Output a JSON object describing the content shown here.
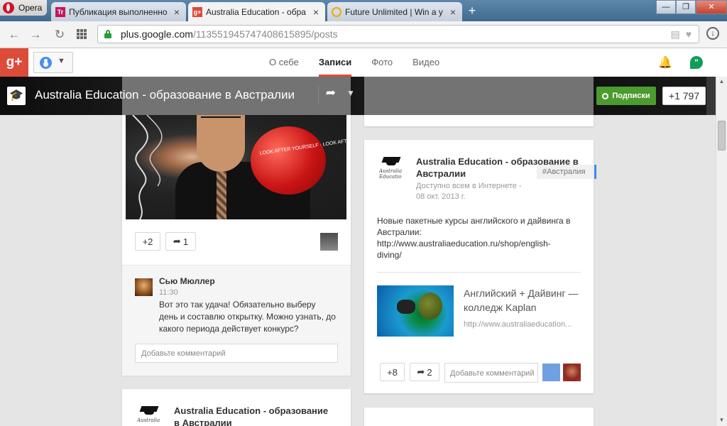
{
  "browser": {
    "app_name": "Opera",
    "tabs": [
      {
        "title": "Публикация выполненно",
        "favicon": "Tr",
        "favicon_color": "#c2185b"
      },
      {
        "title": "Australia Education - обра",
        "favicon": "g+",
        "favicon_color": "#dd4b39",
        "active": true
      },
      {
        "title": "Future Unlimited | Win a y",
        "favicon": "",
        "favicon_color": "#f2a900"
      }
    ],
    "url_host": "plus.google.com",
    "url_path": "/113551945747408615895/posts",
    "window_controls": {
      "minimize": "—",
      "maximize": "❐",
      "close": "✕"
    }
  },
  "gplus": {
    "logo": "g+",
    "nav": [
      {
        "label": "О себе"
      },
      {
        "label": "Записи",
        "active": true
      },
      {
        "label": "Фото"
      },
      {
        "label": "Видео"
      }
    ]
  },
  "profile": {
    "name": "Australia Education - образование в Австралии",
    "follow_label": "Подписки",
    "plus_count": "+1 797",
    "accent_color": "#4b9b2f"
  },
  "left_post": {
    "photo_text": "LOOK AFTER YOURSELF · LOOK AFTER ONE ANOTHER",
    "plus_label": "+2",
    "share_label": "1",
    "comment": {
      "author": "Сью Мюллер",
      "time": "11:30",
      "text": "Вот это так удача! Обязательно выберу день и составлю открытку. Можно узнать, до какого периода действует конкурс?"
    },
    "comment_placeholder": "Добавьте комментарий"
  },
  "left_post_2": {
    "author": "Australia Education - образование в Австралии",
    "logo_text": "Australia"
  },
  "right_post": {
    "author": "Australia Education - образование в Австралии",
    "logo_text": "Australia Educatio",
    "visibility": "Доступно всем в Интернете",
    "separator": "-",
    "date": "08 окт. 2013 г.",
    "hashtag": "#Австралия",
    "text_line1": "Новые пакетные курсы английского и дайвинга в Австралии:",
    "text_line2": "http://www.australiaeducation.ru/shop/english-diving/",
    "link_title": "Английский + Дайвинг — колледж Kaplan",
    "link_url": "http://www.australiaeducation...",
    "plus_label": "+8",
    "share_label": "2",
    "comment_placeholder": "Добавьте комментарий"
  },
  "icons": {
    "back": "back-arrow-icon",
    "forward": "forward-arrow-icon",
    "reload": "reload-icon",
    "speed_dial": "grid-icon",
    "share": "share-arrow-icon",
    "bell": "bell-icon",
    "hangouts": "hangouts-icon"
  }
}
